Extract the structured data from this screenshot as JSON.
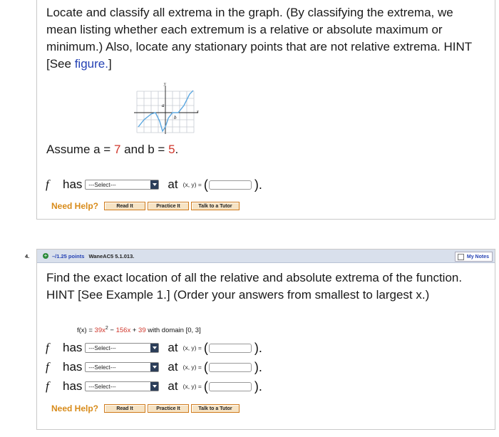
{
  "q3": {
    "text": "Locate and classify all extrema in the graph. (By classifying the extrema, we mean listing whether each extremum is a relative or absolute maximum or minimum.) Also, locate any stationary points that are not relative extrema.",
    "hint_prefix": "HINT [See ",
    "hint_link": "figure.",
    "hint_suffix": "]",
    "graph_labels": {
      "y": "y",
      "x": "x",
      "a": "a",
      "b": "b"
    },
    "assume_prefix": "Assume a = ",
    "a_value": "7",
    "assume_mid": " and b = ",
    "b_value": "5",
    "assume_suffix": ".",
    "answer": {
      "f": "f",
      "has": "has",
      "select": "---Select---",
      "at": "at",
      "xy": "(x, y) =",
      "open": "(",
      "close": ")."
    },
    "help": {
      "label": "Need Help?",
      "read": "Read It",
      "practice": "Practice It",
      "tutor": "Talk to a Tutor"
    }
  },
  "q4": {
    "number": "4.",
    "points": "–/1.25 points",
    "source": "WaneAC5 5.1.013.",
    "my_notes": "My Notes",
    "text": "Find the exact location of all the relative and absolute extrema of the function. HINT [See Example 1.] (Order your answers from smallest to largest x.)",
    "function_prefix": "f(x) = ",
    "function_c1": "39x",
    "function_exp": "2",
    "function_mid1": " − ",
    "function_c2": "156x",
    "function_mid2": " + ",
    "function_c3": "39",
    "function_suffix": " with domain [0, 3]",
    "answers": [
      {
        "f": "f",
        "has": "has",
        "select": "---Select---",
        "at": "at",
        "xy": "(x, y) =",
        "open": "(",
        "close": ")."
      },
      {
        "f": "f",
        "has": "has",
        "select": "---Select---",
        "at": "at",
        "xy": "(x, y) =",
        "open": "(",
        "close": ")."
      },
      {
        "f": "f",
        "has": "has",
        "select": "---Select---",
        "at": "at",
        "xy": "(x, y) =",
        "open": "(",
        "close": ")."
      }
    ],
    "help": {
      "label": "Need Help?",
      "read": "Read It",
      "practice": "Practice It",
      "tutor": "Talk to a Tutor"
    }
  },
  "colors": {
    "link": "#2542b4",
    "number": "#d0362b",
    "help": "#d88b1a",
    "header": "#d9e0ec",
    "curve": "#5ba7e0"
  }
}
